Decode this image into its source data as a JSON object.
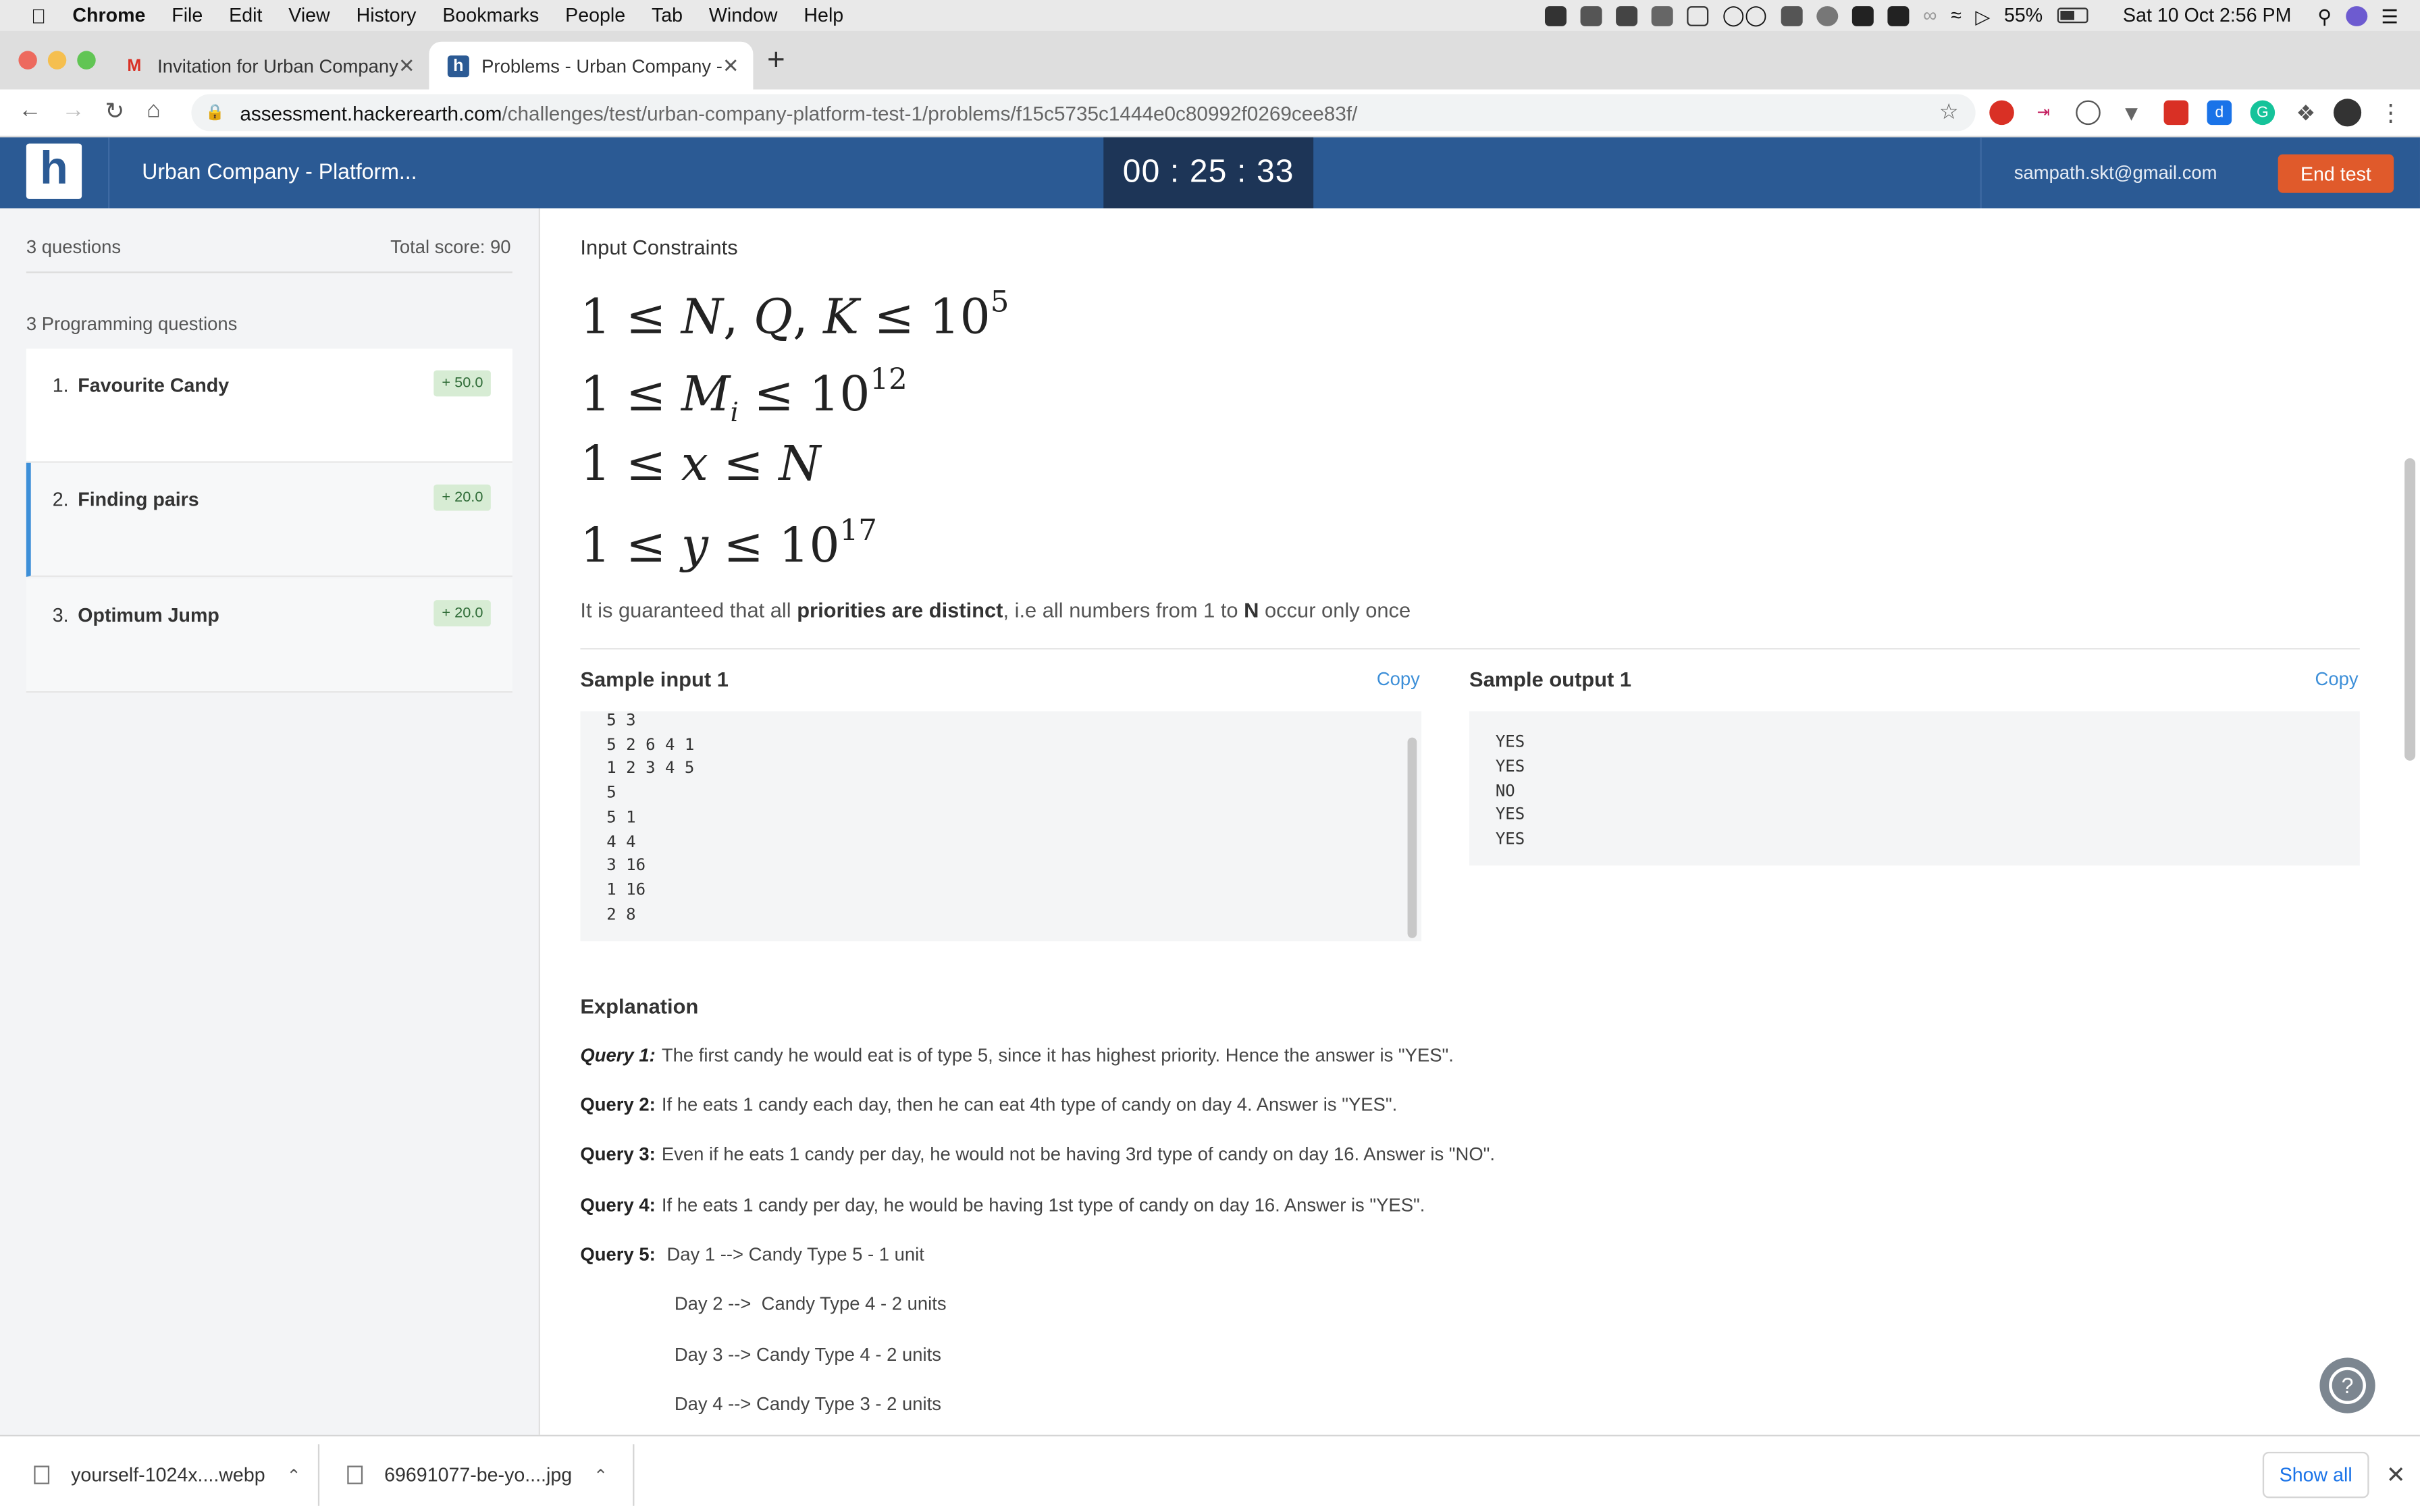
{
  "menubar": {
    "app": "Chrome",
    "items": [
      "File",
      "Edit",
      "View",
      "History",
      "Bookmarks",
      "People",
      "Tab",
      "Window",
      "Help"
    ],
    "battery": "55%",
    "clock": "Sat 10 Oct  2:56 PM"
  },
  "tabs": [
    {
      "title": "Invitation for Urban Company -",
      "icon": "gmail-icon"
    },
    {
      "title": "Problems - Urban Company - P",
      "icon": "hackerearth-icon"
    }
  ],
  "address": {
    "host": "assessment.hackerearth.com",
    "path": "/challenges/test/urban-company-platform-test-1/problems/f15c5735c1444e0c80992f0269cee83f/"
  },
  "header": {
    "logo": "h",
    "title": "Urban Company - Platform...",
    "timer": "00 : 25 : 33",
    "email": "sampath.skt@gmail.com",
    "end_test": "End test"
  },
  "sidebar": {
    "questions_count": "3 questions",
    "total_score": "Total score: 90",
    "programming_label": "3 Programming questions",
    "questions": [
      {
        "num": "1.",
        "title": "Favourite Candy",
        "score": "+ 50.0"
      },
      {
        "num": "2.",
        "title": "Finding pairs",
        "score": "+ 20.0"
      },
      {
        "num": "3.",
        "title": "Optimum Jump",
        "score": "+ 20.0"
      }
    ]
  },
  "problem": {
    "constraints_title": "Input Constraints",
    "constraint_note_pre": "It is guaranteed that all ",
    "constraint_note_bold": "priorities are distinct",
    "constraint_note_mid": ", i.e all numbers from 1 to ",
    "constraint_note_n": "N",
    "constraint_note_post": " occur only once",
    "sample_input_title": "Sample input 1",
    "sample_output_title": "Sample output 1",
    "copy_label": "Copy",
    "sample_input": [
      "5 3",
      "5 2 6 4 1",
      "1 2 3 4 5",
      "5",
      "5 1",
      "4 4",
      "3 16",
      "1 16",
      "2 8"
    ],
    "sample_output": [
      "YES",
      "YES",
      "NO",
      "YES",
      "YES"
    ],
    "explanation_title": "Explanation",
    "queries": [
      {
        "label": "Query 1:",
        "text": "The first candy he would eat is of type 5, since it has highest priority. Hence the answer is \"YES\"."
      },
      {
        "label": "Query 2:",
        "text": "If he eats 1 candy each day, then he can eat 4th type of candy on day 4. Answer is \"YES\"."
      },
      {
        "label": "Query 3:",
        "text": "Even if he eats 1 candy per day, he would not be having 3rd type of candy on day 16. Answer is \"NO\"."
      },
      {
        "label": "Query 4:",
        "text": "If he eats 1 candy per day, he would be having 1st type of candy on day 16. Answer is \"YES\"."
      },
      {
        "label": "Query 5:",
        "text": " Day 1 --> Candy Type 5 - 1 unit"
      }
    ],
    "days": [
      "Day 2 -->  Candy Type 4 - 2 units",
      "Day 3 --> Candy Type 4 - 2 units",
      "Day 4 --> Candy Type 3 - 2 units"
    ]
  },
  "downloads": {
    "items": [
      "yourself-1024x....webp",
      "69691077-be-yo....jpg"
    ],
    "show_all": "Show all"
  }
}
